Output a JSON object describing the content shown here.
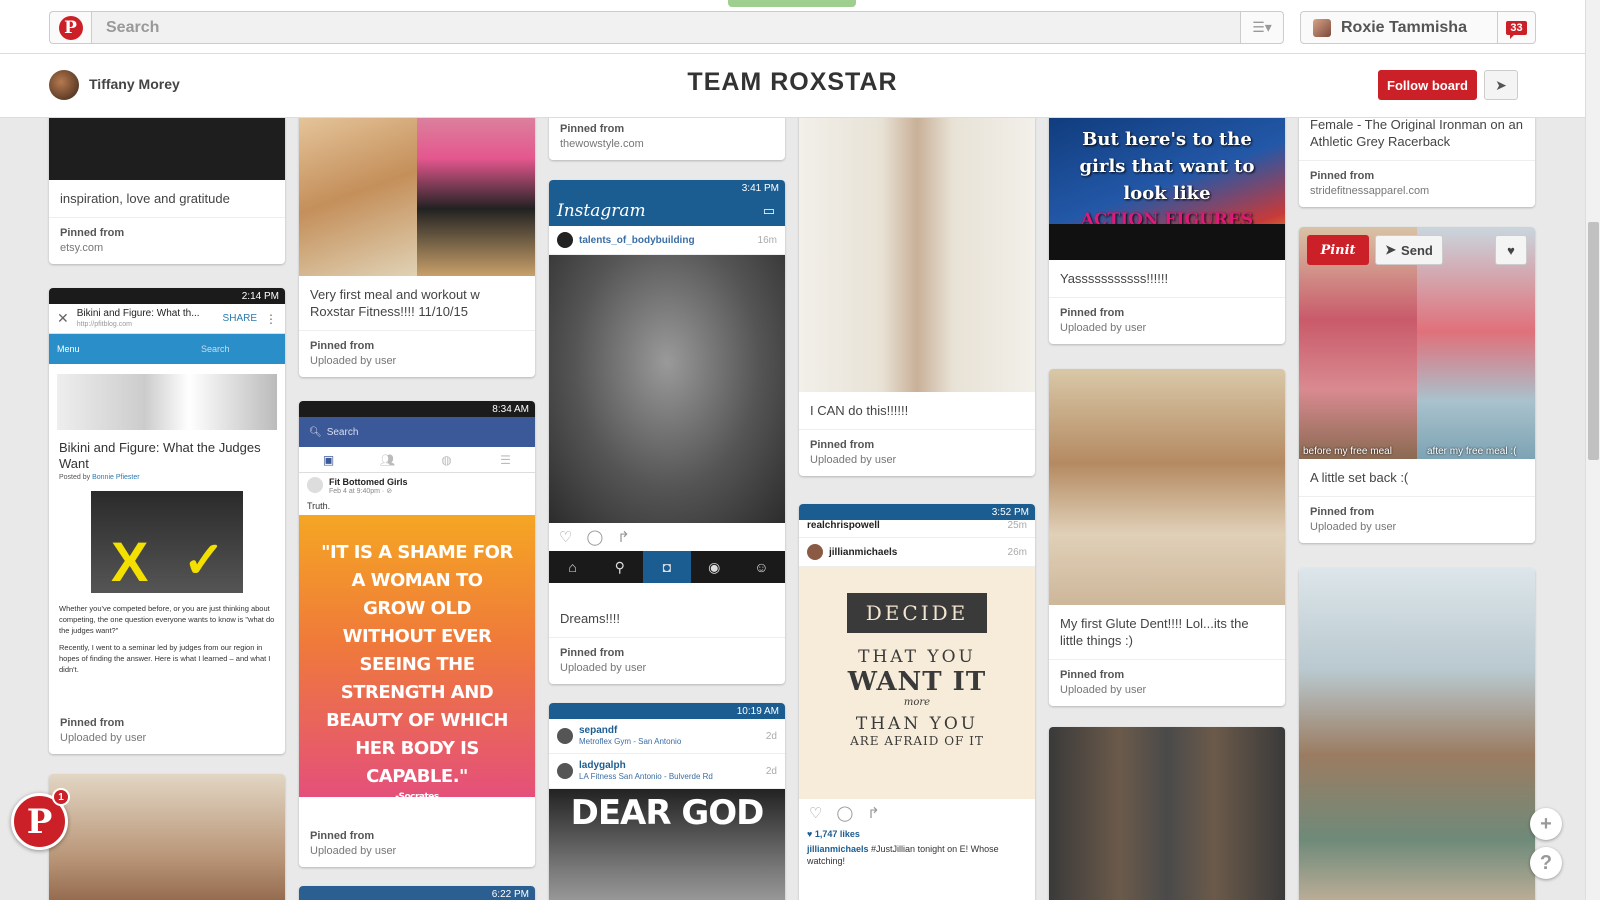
{
  "nav": {
    "search_placeholder": "Search",
    "user_name": "Roxie Tammisha",
    "notification_count": "33"
  },
  "board": {
    "owner_name": "Tiffany Morey",
    "title": "TEAM ROXSTAR",
    "follow_label": "Follow board"
  },
  "pins": {
    "c1a": {
      "desc": "inspiration, love and gratitude",
      "src_label": "Pinned from",
      "src": "etsy.com"
    },
    "c1b": {
      "status_time": "2:14 PM",
      "browser_title": "Bikini and Figure: What th...",
      "browser_url": "http://pfitblog.com",
      "share": "SHARE",
      "menu": "Menu",
      "search": "Search",
      "desc": "Bikini and Figure: What the Judges Want",
      "posted_by_label": "Posted by",
      "posted_by": "Bonnie Pfiester",
      "body1": "Whether you've competed before, or you are just thinking about competing, the one question everyone wants to know is \"what do the judges want?\"",
      "body2": "Recently, I went to a seminar led by judges from our region in hopes of finding the answer. Here is what I learned – and what I didn't.",
      "src_label": "Pinned from",
      "src": "Uploaded by user"
    },
    "c2a": {
      "desc": "Very first meal and workout w Roxstar Fitness!!!! 11/10/15",
      "src_label": "Pinned from",
      "src": "Uploaded by user"
    },
    "c2b": {
      "status_time": "8:34 AM",
      "search": "Search",
      "author": "Fit Bottomed Girls",
      "post_time": "Feb 4 at 9:40pm · ⊘",
      "post_text": "Truth.",
      "quote": "\"IT IS A SHAME FOR A WOMAN TO GROW OLD WITHOUT EVER SEEING THE STRENGTH AND BEAUTY OF WHICH HER BODY IS CAPABLE.\"",
      "quote_author": "-Socrates",
      "src_label": "Pinned from",
      "src": "Uploaded by user"
    },
    "c2c": {
      "status_time": "6:22 PM"
    },
    "c3a": {
      "src_label": "Pinned from",
      "src": "thewowstyle.com"
    },
    "c3b": {
      "status_time": "3:41 PM",
      "app_name": "Instagram",
      "user": "talents_of_bodybuilding",
      "age": "16m",
      "desc": "Dreams!!!!",
      "src_label": "Pinned from",
      "src": "Uploaded by user"
    },
    "c3c": {
      "status_time": "10:19 AM",
      "user1": "sepandf",
      "loc1": "Metroflex Gym - San Antonio",
      "age1": "2d",
      "user2": "ladygalph",
      "loc2": "LA Fitness San Antonio - Bulverde Rd",
      "age2": "2d",
      "meme_text": "DEAR GOD"
    },
    "c4a": {
      "desc": "I CAN do this!!!!!!",
      "src_label": "Pinned from",
      "src": "Uploaded by user"
    },
    "c4b": {
      "status_time": "3:52 PM",
      "user_top": "realchrispowell",
      "age_top": "25m",
      "user": "jillianmichaels",
      "age": "26m",
      "poster_1": "DECIDE",
      "poster_2": "THAT YOU",
      "poster_3": "WANT IT",
      "poster_4": "more",
      "poster_5": "THAN YOU",
      "poster_6": "ARE AFRAID OF IT",
      "likes": "♥ 1,747 likes",
      "caption_user": "jillianmichaels",
      "caption": "#JustJillian tonight on E! Whose watching!"
    },
    "c5a": {
      "img_text": "But here's to the girls that want to look like",
      "img_text2": "ACTION FIGURES",
      "desc": "Yasssssssssss!!!!!!",
      "src_label": "Pinned from",
      "src": "Uploaded by user"
    },
    "c5b": {
      "desc": "My first Glute Dent!!!! Lol...its the little things :)",
      "src_label": "Pinned from",
      "src": "Uploaded by user"
    },
    "c6a": {
      "desc": "Female - The Original Ironman on an Athletic Grey Racerback",
      "src_label": "Pinned from",
      "src": "stridefitnessapparel.com"
    },
    "c6b": {
      "pinit": "Pinit",
      "send": "Send",
      "cap_left": "before my free meal",
      "cap_right": "after my free meal :(",
      "desc": "A little set back :(",
      "src_label": "Pinned from",
      "src": "Uploaded by user"
    }
  },
  "floating": {
    "badge": "1",
    "plus": "+",
    "help": "?"
  },
  "colors": {
    "brand_red": "#cb2027",
    "instagram_blue": "#1c5d91",
    "facebook_blue": "#3b5998"
  }
}
